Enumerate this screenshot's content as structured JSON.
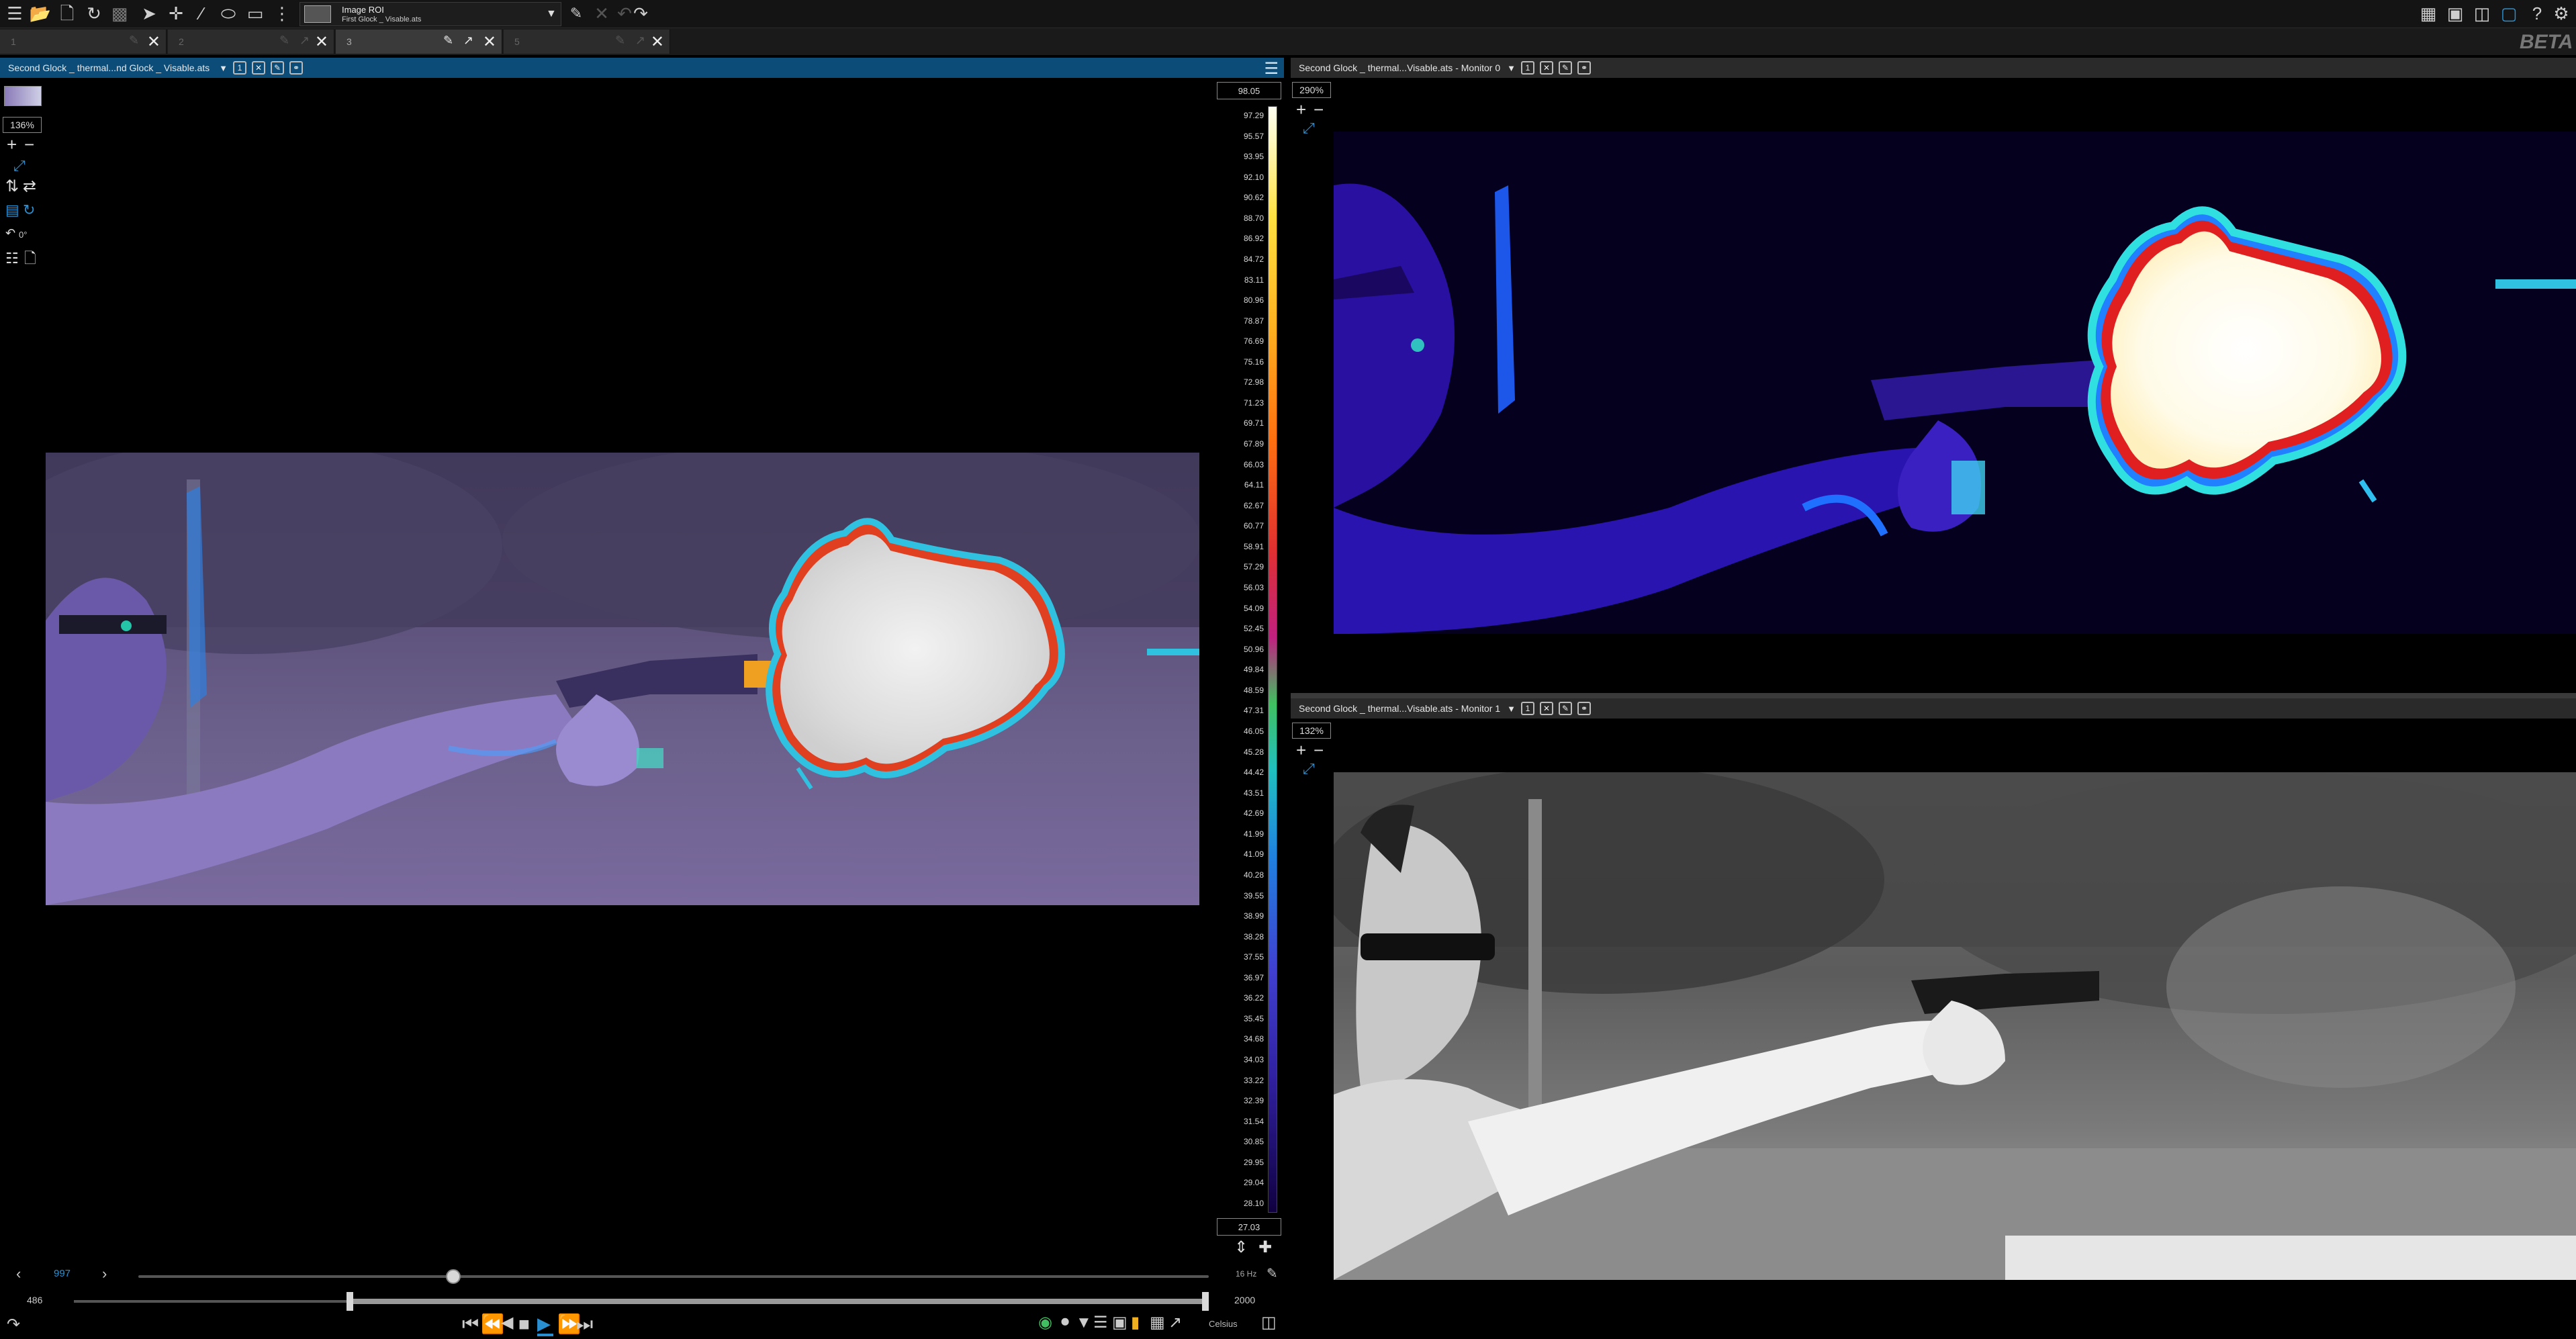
{
  "toolbar": {
    "roi_title": "Image ROI",
    "roi_file": "First Glock _ Visable.ats",
    "beta_label": "BETA"
  },
  "doc_tabs": [
    {
      "label": "1"
    },
    {
      "label": "2"
    },
    {
      "label": "3"
    },
    {
      "label": "5"
    }
  ],
  "viewport_main": {
    "title": "Second Glock _ thermal...nd Glock _ Visable.ats",
    "badge": "1",
    "zoom": "136%",
    "rotation": "0°"
  },
  "viewport_monitor0": {
    "title": "Second Glock _ thermal...Visable.ats - Monitor 0",
    "badge": "1",
    "zoom": "290%"
  },
  "viewport_monitor1": {
    "title": "Second Glock _ thermal...Visable.ats - Monitor 1",
    "badge": "1",
    "zoom": "132%"
  },
  "scale": {
    "max": "98.05",
    "min": "27.03",
    "labels": [
      "97.29",
      "95.57",
      "93.95",
      "92.10",
      "90.62",
      "88.70",
      "86.92",
      "84.72",
      "83.11",
      "80.96",
      "78.87",
      "76.69",
      "75.16",
      "72.98",
      "71.23",
      "69.71",
      "67.89",
      "66.03",
      "64.11",
      "62.67",
      "60.77",
      "58.91",
      "57.29",
      "56.03",
      "54.09",
      "52.45",
      "50.96",
      "49.84",
      "48.59",
      "47.31",
      "46.05",
      "45.28",
      "44.42",
      "43.51",
      "42.69",
      "41.99",
      "41.09",
      "40.28",
      "39.55",
      "38.99",
      "38.28",
      "37.55",
      "36.97",
      "36.22",
      "35.45",
      "34.68",
      "34.03",
      "33.22",
      "32.39",
      "31.54",
      "30.85",
      "29.95",
      "29.04",
      "28.10"
    ]
  },
  "playback": {
    "current_frame": "997",
    "range_start": "486",
    "range_end": "2000",
    "rate": "16 Hz",
    "unit": "Celsius",
    "frame_position": 0.294,
    "range_start_fraction": 0.243,
    "range_end_fraction": 1.0
  },
  "colors": {
    "accent": "#2a8fd0",
    "header_bar": "#0b4c78",
    "header_bar_gray": "#2a2a2a"
  }
}
